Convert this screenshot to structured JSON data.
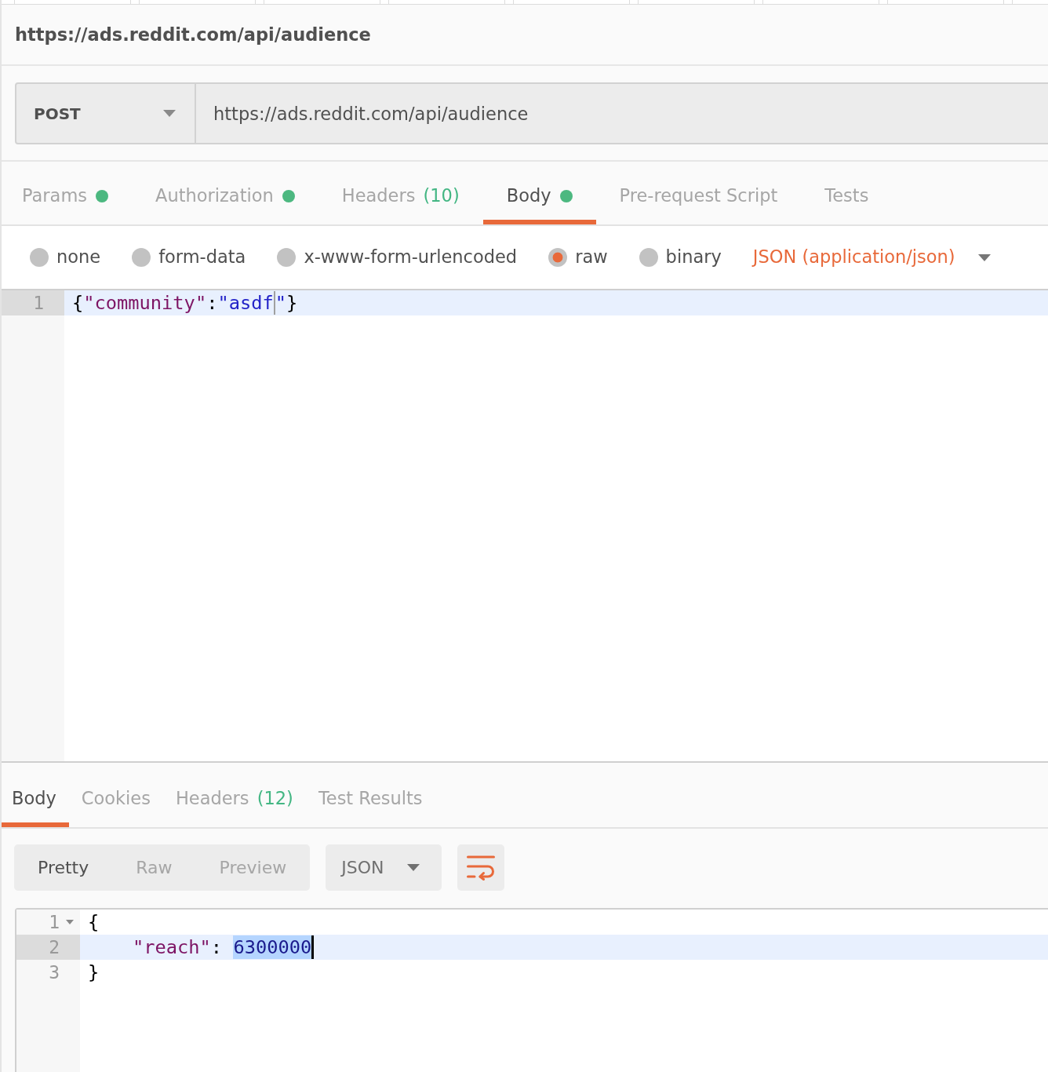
{
  "request": {
    "title": "https://ads.reddit.com/api/audience",
    "method": "POST",
    "url": "https://ads.reddit.com/api/audience"
  },
  "request_tabs": [
    {
      "label": "Params",
      "indicator": true,
      "selected": false
    },
    {
      "label": "Authorization",
      "indicator": true,
      "selected": false
    },
    {
      "label": "Headers",
      "count": "(10)",
      "indicator": false,
      "selected": false
    },
    {
      "label": "Body",
      "indicator": true,
      "selected": true
    },
    {
      "label": "Pre-request Script",
      "indicator": false,
      "selected": false
    },
    {
      "label": "Tests",
      "indicator": false,
      "selected": false
    }
  ],
  "body_types": [
    {
      "label": "none",
      "selected": false
    },
    {
      "label": "form-data",
      "selected": false
    },
    {
      "label": "x-www-form-urlencoded",
      "selected": false
    },
    {
      "label": "raw",
      "selected": true
    },
    {
      "label": "binary",
      "selected": false
    }
  ],
  "content_type": {
    "label": "JSON (application/json)"
  },
  "request_body": {
    "focused": false,
    "lines": [
      {
        "number": "1",
        "active": true,
        "foldable": false,
        "indented": false,
        "tokens": [
          {
            "kind": "punct",
            "text": "{",
            "selected": false,
            "cursor": false
          },
          {
            "kind": "key",
            "text": "\"community\"",
            "selected": false,
            "cursor": false
          },
          {
            "kind": "punct",
            "text": ":",
            "selected": false,
            "cursor": false
          },
          {
            "kind": "string",
            "text": "\"asdf",
            "selected": false,
            "cursor": true
          },
          {
            "kind": "string",
            "text": "\"",
            "selected": false,
            "cursor": false
          },
          {
            "kind": "punct",
            "text": "}",
            "selected": false,
            "cursor": false
          }
        ]
      }
    ]
  },
  "response_tabs": [
    {
      "label": "Body",
      "selected": true
    },
    {
      "label": "Cookies",
      "selected": false
    },
    {
      "label": "Headers",
      "count": "(12)",
      "selected": false
    },
    {
      "label": "Test Results",
      "selected": false
    }
  ],
  "view_modes": [
    {
      "label": "Pretty",
      "selected": true
    },
    {
      "label": "Raw",
      "selected": false
    },
    {
      "label": "Preview",
      "selected": false
    }
  ],
  "format": {
    "label": "JSON"
  },
  "wrap_lines": {
    "on": true
  },
  "response_body": {
    "focused": true,
    "lines": [
      {
        "number": "1",
        "active": false,
        "foldable": true,
        "indented": false,
        "tokens": [
          {
            "kind": "punct",
            "text": "{",
            "selected": false,
            "cursor": false
          }
        ]
      },
      {
        "number": "2",
        "active": true,
        "foldable": false,
        "indented": true,
        "tokens": [
          {
            "kind": "key",
            "text": "\"reach\"",
            "selected": false,
            "cursor": false
          },
          {
            "kind": "punct",
            "text": ": ",
            "selected": false,
            "cursor": false
          },
          {
            "kind": "number",
            "text": "6300000",
            "selected": true,
            "cursor": true
          }
        ]
      },
      {
        "number": "3",
        "active": false,
        "foldable": false,
        "indented": false,
        "tokens": [
          {
            "kind": "punct",
            "text": "}",
            "selected": false,
            "cursor": false
          }
        ]
      }
    ]
  }
}
